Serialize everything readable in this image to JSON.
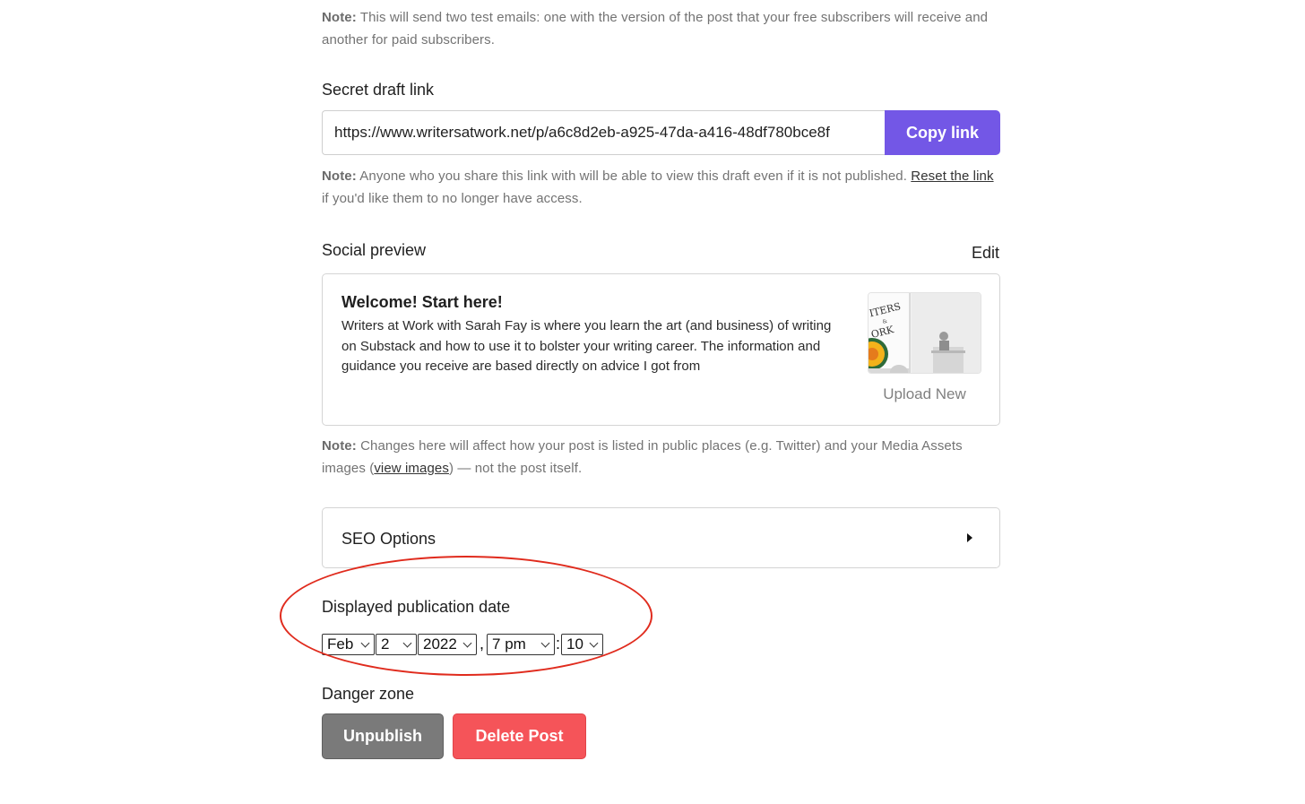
{
  "test_email": {
    "note_label": "Note:",
    "note_text": " This will send two test emails: one with the version of the post that your free subscribers will receive and another for paid subscribers."
  },
  "secret_link": {
    "title": "Secret draft link",
    "url": "https://www.writersatwork.net/p/a6c8d2eb-a925-47da-a416-48df780bce8f",
    "copy_label": "Copy link",
    "note_label": "Note:",
    "note_text_1": " Anyone who you share this link with will be able to view this draft even if it is not published. ",
    "reset_link": "Reset the link",
    "note_text_2": " if you'd like them to no longer have access."
  },
  "social_preview": {
    "title": "Social preview",
    "edit_label": "Edit",
    "card_title": "Welcome! Start here!",
    "card_description": "Writers at Work with Sarah Fay is where you learn the art (and business) of writing on Substack and how to use it to bolster your writing career. The information and guidance you receive are based directly on advice I got from",
    "upload_label": "Upload New",
    "thumb_text_1": "ITERS",
    "thumb_text_2": "&",
    "thumb_text_3": "ORK",
    "note_label": "Note:",
    "note_text_1": " Changes here will affect how your post is listed in public places (e.g. Twitter) and your Media Assets images (",
    "view_images_link": "view images",
    "note_text_2": ") — not the post itself."
  },
  "seo": {
    "label": "SEO Options"
  },
  "publication_date": {
    "title": "Displayed publication date",
    "month": "Feb",
    "day": "2",
    "year": "2022",
    "comma": ",",
    "hour": "7 pm",
    "colon": ":",
    "minute": "10"
  },
  "danger_zone": {
    "title": "Danger zone",
    "unpublish_label": "Unpublish",
    "delete_label": "Delete Post"
  },
  "colors": {
    "accent": "#7357e6",
    "danger": "#f55459",
    "neutral_button": "#7a7a7a",
    "annotation": "#e02b1d"
  }
}
